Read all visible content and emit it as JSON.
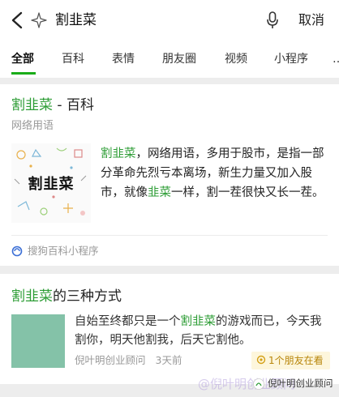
{
  "search": {
    "query": "割韭菜",
    "cancel_label": "取消"
  },
  "tabs": [
    {
      "label": "全部",
      "active": true
    },
    {
      "label": "百科"
    },
    {
      "label": "表情"
    },
    {
      "label": "朋友圈"
    },
    {
      "label": "视频"
    },
    {
      "label": "小程序"
    },
    {
      "label": "…"
    }
  ],
  "colors": {
    "accent_green": "#2e9d36",
    "tab_underline": "#1aad19",
    "badge_bg": "#fdf6dc",
    "badge_text": "#b8860b"
  },
  "results": [
    {
      "title_highlight": "割韭菜",
      "title_rest": " - 百科",
      "subtitle": "网络用语",
      "thumbnail_text": "割韭菜",
      "desc_highlight_1": "割韭菜",
      "desc_part_1": "，网络用语，多用于股市，是指一部分革命先烈亏本离场，新生力量又加入股市，就像",
      "desc_highlight_2": "韭菜",
      "desc_part_2": "一样，割一茬很快又长一茬。",
      "source": "搜狗百科小程序"
    },
    {
      "title_highlight": "割韭菜",
      "title_rest": "的三种方式",
      "desc_part_1": "自始至终都只是一个",
      "desc_highlight_1": "割韭菜",
      "desc_part_2": "的游戏而已，今天我割你，明天他割我，后天它割他。",
      "author": "倪叶明创业顾问",
      "time": "3天前",
      "badge": "1个朋友在看"
    }
  ],
  "watermark": {
    "text": "@倪叶明创业顾问",
    "badge": "倪叶明创业顾问"
  }
}
